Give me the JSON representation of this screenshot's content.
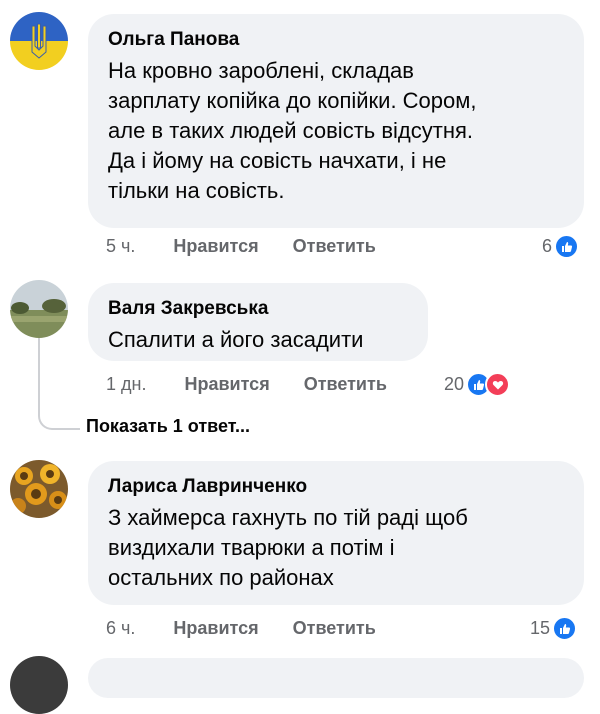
{
  "comments": [
    {
      "author": "Ольга Панова",
      "text": "На кровно зароблені, складав\nзарплату копійка до копійки. Сором,\nале в таких людей совість відсутня.\nДа і йому на совість начхати, і не\nтільки на совість.",
      "time": "5 ч.",
      "like_label": "Нравится",
      "reply_label": "Ответить",
      "reaction_count": "6",
      "reactions": [
        "like"
      ]
    },
    {
      "author": "Валя Закревська",
      "text": "Спалити а його засадити",
      "time": "1 дн.",
      "like_label": "Нравится",
      "reply_label": "Ответить",
      "reaction_count": "20",
      "reactions": [
        "like",
        "love"
      ]
    },
    {
      "author": "Лариса Лавринченко",
      "text": "З хаймерса гахнуть по тій раді щоб\nвиздихали тварюки а потім і\nостальних по районах",
      "time": "6 ч.",
      "like_label": "Нравится",
      "reply_label": "Ответить",
      "reaction_count": "15",
      "reactions": [
        "like"
      ]
    }
  ],
  "show_replies_label": "Показать 1 ответ...",
  "colors": {
    "like": "#1877f2",
    "love": "#f33e58",
    "bubble": "#f0f2f5",
    "meta": "#65676b"
  }
}
